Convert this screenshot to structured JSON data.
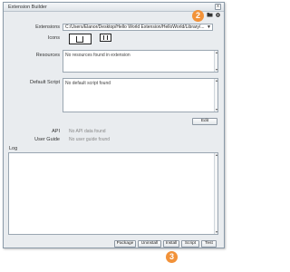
{
  "window": {
    "title": "Extension Builder",
    "close_glyph": "x"
  },
  "toolbar": {
    "folder_icon": "folder-icon",
    "gear_icon": "gear-icon"
  },
  "fields": {
    "extensions_label": "Extensions",
    "extensions_value": "C:/Users/Elanor/Desktop/Hello World Extension/HelloWorld/Library/...",
    "icons_label": "Icons",
    "resources_label": "Resources",
    "resources_value": "No resources found in extension",
    "default_script_label": "Default Script",
    "default_script_value": "No default script found",
    "edit_button": "Edit",
    "api_label": "API",
    "api_value": "No API data found",
    "user_guide_label": "User Guide",
    "user_guide_value": "No user guide found",
    "log_label": "Log"
  },
  "buttons": {
    "package": "Package",
    "uninstall": "Uninstall",
    "install": "Install",
    "script": "Script",
    "test": "Test"
  },
  "callouts": {
    "toolbar_badge": "2",
    "install_badge": "3"
  },
  "colors": {
    "badge": "#f29239",
    "window_bg": "#e9ecef"
  }
}
